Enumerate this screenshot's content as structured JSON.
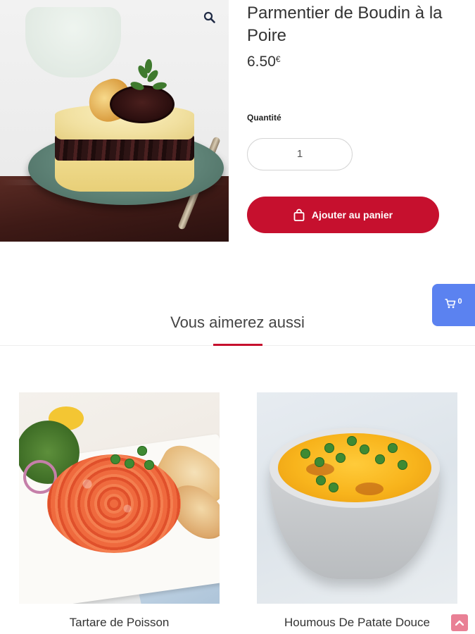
{
  "product": {
    "title": "Parmentier de Boudin à la Poire",
    "price_amount": "6.50",
    "price_currency": "€",
    "quantity_label": "Quantité",
    "quantity_value": "1",
    "add_to_cart_label": "Ajouter au panier",
    "image_icon": "zoom-icon"
  },
  "floating_cart": {
    "icon": "cart-icon",
    "count": "0",
    "color": "#5b82f0"
  },
  "related": {
    "heading": "Vous aimerez aussi",
    "items": [
      {
        "title": "Tartare de Poisson"
      },
      {
        "title": "Houmous De Patate Douce"
      }
    ]
  },
  "colors": {
    "accent": "#c6102e",
    "scroll_top": "#e98095"
  }
}
